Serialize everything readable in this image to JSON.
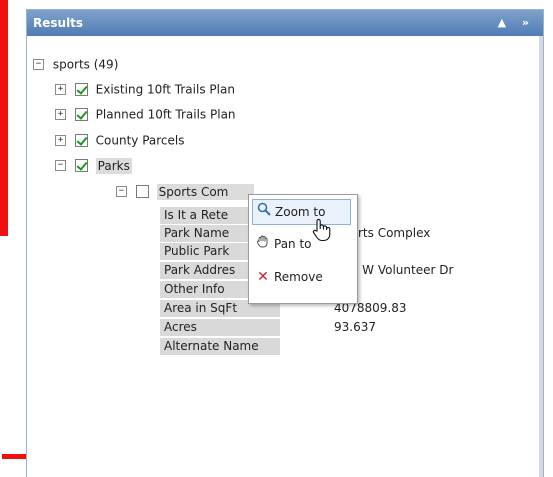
{
  "panel": {
    "title": "Results",
    "controls": "▲ »"
  },
  "tree": {
    "root": {
      "toggle": "−",
      "label": "sports (49)"
    },
    "layers": [
      {
        "toggle": "+",
        "label": "Existing 10ft Trails Plan",
        "checked": true
      },
      {
        "toggle": "+",
        "label": "Planned 10ft Trails Plan",
        "checked": true
      },
      {
        "toggle": "+",
        "label": "County Parcels",
        "checked": true
      },
      {
        "toggle": "−",
        "label": "Parks",
        "checked": true
      }
    ],
    "feature": {
      "toggle": "−",
      "label": "Sports Com",
      "checked": false
    },
    "attributes": [
      {
        "name": "Is It a Rete",
        "value": ""
      },
      {
        "name": "Park Name",
        "value": "rts Complex"
      },
      {
        "name": "Public Park",
        "value": ""
      },
      {
        "name": "Park Addres",
        "value": "- W Volunteer Dr"
      },
      {
        "name": "Other Info",
        "value": ""
      },
      {
        "name": "Area in SqFt",
        "value": "4078809.83"
      },
      {
        "name": "Acres",
        "value": "93.637"
      },
      {
        "name": "Alternate Name",
        "value": ""
      }
    ]
  },
  "context_menu": {
    "items": [
      {
        "label": "Zoom to",
        "icon": "magnifier-icon",
        "active": true
      },
      {
        "label": "Pan to",
        "icon": "hand-icon",
        "active": false
      },
      {
        "label": "Remove",
        "icon": "x-icon",
        "active": false
      }
    ]
  },
  "colors": {
    "titlebar": "#5a86bd",
    "annotation_red": "#ee1111",
    "check_green": "#1a9a1a",
    "remove_red": "#cc2222"
  }
}
